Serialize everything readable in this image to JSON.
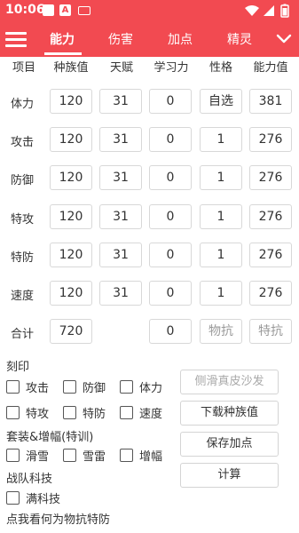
{
  "status_bar": {
    "time": "10:06",
    "icons": [
      "notification-square-icon",
      "a-badge-icon",
      "keyboard-icon",
      "wifi-icon",
      "signal-icon",
      "battery-icon"
    ]
  },
  "app_bar": {
    "tabs": [
      {
        "label": "能力",
        "active": true
      },
      {
        "label": "伤害",
        "active": false
      },
      {
        "label": "加点",
        "active": false
      },
      {
        "label": "精灵",
        "active": false
      }
    ]
  },
  "table": {
    "headers": [
      "项目",
      "种族值",
      "天赋",
      "学习力",
      "性格",
      "能力值"
    ],
    "rows": [
      {
        "label": "体力",
        "base": "120",
        "iv": "31",
        "ev": "0",
        "nature": "自选",
        "stat": "381"
      },
      {
        "label": "攻击",
        "base": "120",
        "iv": "31",
        "ev": "0",
        "nature": "1",
        "stat": "276"
      },
      {
        "label": "防御",
        "base": "120",
        "iv": "31",
        "ev": "0",
        "nature": "1",
        "stat": "276"
      },
      {
        "label": "特攻",
        "base": "120",
        "iv": "31",
        "ev": "0",
        "nature": "1",
        "stat": "276"
      },
      {
        "label": "特防",
        "base": "120",
        "iv": "31",
        "ev": "0",
        "nature": "1",
        "stat": "276"
      },
      {
        "label": "速度",
        "base": "120",
        "iv": "31",
        "ev": "0",
        "nature": "1",
        "stat": "276"
      }
    ],
    "total": {
      "label": "合计",
      "base": "720",
      "ev": "0",
      "phys_res_hint": "物抗",
      "spec_res_hint": "特抗"
    }
  },
  "imprint": {
    "title": "刻印",
    "options": [
      "攻击",
      "防御",
      "体力",
      "特攻",
      "特防",
      "速度"
    ]
  },
  "suit": {
    "title": "套装&增幅(特训)",
    "options": [
      "滑雪",
      "雪雷",
      "增幅"
    ]
  },
  "team_tech": {
    "title": "战队科技",
    "options": [
      "满科技"
    ]
  },
  "footer_hint": "点我看何为物抗特防",
  "buttons": {
    "side_slide": "侧滑真皮沙发",
    "download": "下载种族值",
    "save": "保存加点",
    "calc": "计算"
  },
  "colors": {
    "brand": "#f24a51"
  }
}
